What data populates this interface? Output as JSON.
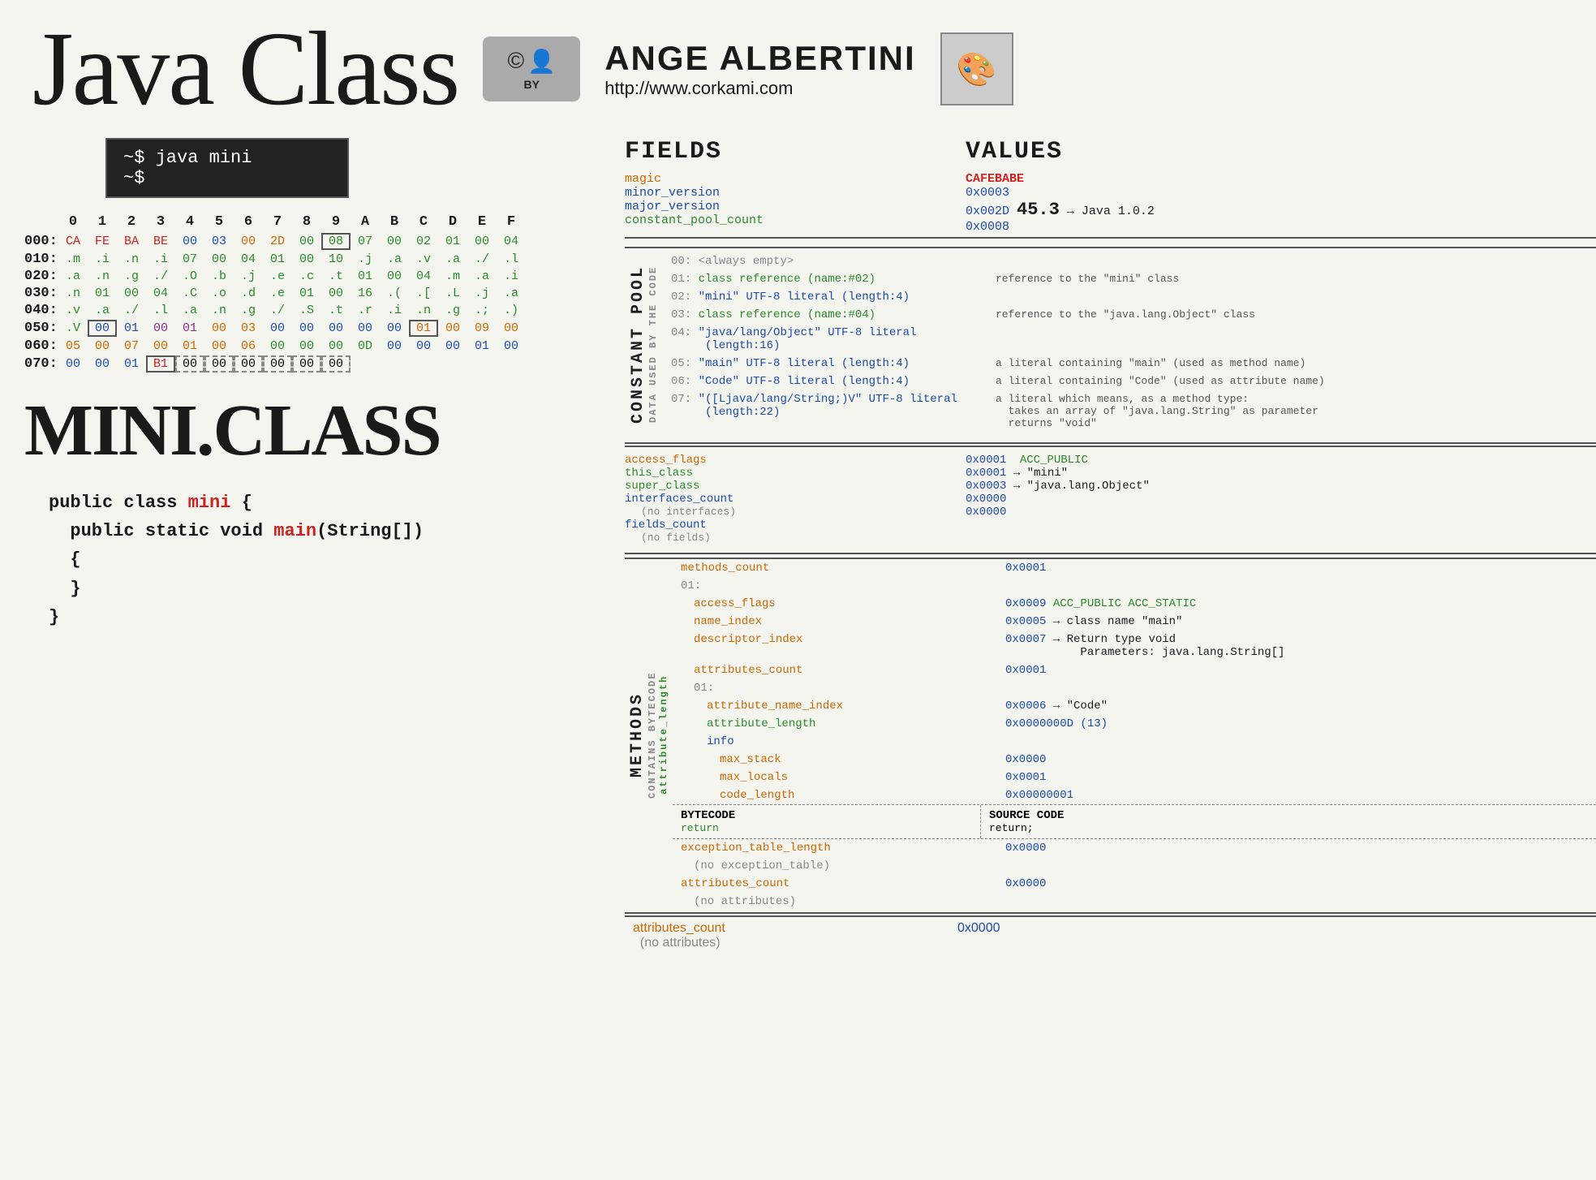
{
  "header": {
    "title": "Java Class",
    "cc_label": "BY",
    "author_name": "ANGE ALBERTINI",
    "author_url": "http://www.corkami.com"
  },
  "terminal": {
    "line1": "~$ java mini",
    "line2": "~$"
  },
  "hex_header": [
    "0",
    "1",
    "2",
    "3",
    "4",
    "5",
    "6",
    "7",
    "8",
    "9",
    "A",
    "B",
    "C",
    "D",
    "E",
    "F"
  ],
  "hex_rows": [
    {
      "addr": "000:",
      "cells": "CA FE BA BE 00 03 00 2D 00 08 07 00 02 01 00 04"
    },
    {
      "addr": "010:",
      "cells": ".m .i .n .i 07 00 04 01 00 10 .j .a .v .a ./ .l"
    },
    {
      "addr": "020:",
      "cells": ".a .n .g ./ .O .b .j .e .c .t 01 00 04 .m .a .i"
    },
    {
      "addr": "030:",
      "cells": ".n 01 00 04 .C .o .d .e 01 00 16 .( .[ .L .j .a"
    },
    {
      "addr": "040:",
      "cells": ".v .a ./ .l .a .n .g ./ .S .t .r .i .n .g .; .)"
    },
    {
      "addr": "050:",
      "cells": ".V 00 01 00 01 00 03 00 00 00 00 00 01 00 09 00"
    },
    {
      "addr": "060:",
      "cells": "05 00 07 00 01 00 06 00 00 00 0D 00 00 00 01 00"
    },
    {
      "addr": "070:",
      "cells": "00 00 01 B1 00 00 00 00 00 00"
    }
  ],
  "mini_class_title": "MINI.CLASS",
  "code": {
    "line1": "public class mini {",
    "line2": "  public static void main(String[])",
    "line3": "  {",
    "line4": "  }",
    "line5": "}"
  },
  "fields_section": {
    "title": "FIELDS",
    "items": [
      {
        "name": "magic",
        "color": "orange"
      },
      {
        "name": "minor_version",
        "color": "blue"
      },
      {
        "name": "major_version",
        "color": "blue"
      },
      {
        "name": "constant_pool_count",
        "color": "green"
      }
    ]
  },
  "values_section": {
    "title": "VALUES",
    "items": [
      {
        "val": "CAFEBABE",
        "color": "red"
      },
      {
        "val": "0x0003",
        "color": "blue"
      },
      {
        "val": "0x002D  45.3 → Java 1.0.2",
        "color": "blue"
      },
      {
        "val": "0x0008",
        "color": "blue"
      }
    ]
  },
  "constant_pool": {
    "label": "CONSTANT POOL",
    "sublabel": "DATA USED BY THE CODE",
    "count_label": "constant_pool_count",
    "entries": [
      {
        "num": "00:",
        "desc": "<always empty>",
        "note": ""
      },
      {
        "num": "01:",
        "desc_class": "class reference (name:#02)",
        "note": "reference to the \"mini\" class"
      },
      {
        "num": "02:",
        "desc_literal": "\"mini\" UTF-8 literal (length:4)",
        "note": ""
      },
      {
        "num": "03:",
        "desc_class": "class reference (name:#04)",
        "note": "reference to the \"java.lang.Object\" class"
      },
      {
        "num": "04:",
        "desc_literal": "\"java/lang/Object\" UTF-8 literal (length:16)",
        "note": ""
      },
      {
        "num": "05:",
        "desc_literal": "\"main\" UTF-8 literal (length:4)",
        "note": "a literal containing \"main\" (used as method name)"
      },
      {
        "num": "06:",
        "desc_literal": "\"Code\" UTF-8 literal (length:4)",
        "note": "a literal containing \"Code\" (used as attribute name)"
      },
      {
        "num": "07:",
        "desc_literal": "\"([Ljava/lang/String;)V\" UTF-8 literal (length:22)",
        "note": "a literal which means, as a method type:\n  takes an array of \"java.lang.String\" as parameter\n  returns \"void\""
      }
    ]
  },
  "access_flags_section": {
    "fields": [
      {
        "name": "access_flags",
        "color": "orange"
      },
      {
        "name": "this_class",
        "color": "blue"
      },
      {
        "name": "super_class",
        "color": "blue"
      },
      {
        "name": "interfaces_count",
        "color": "blue"
      },
      {
        "sub": "(no interfaces)"
      },
      {
        "name": "fields_count",
        "color": "blue"
      },
      {
        "sub": "(no fields)"
      }
    ],
    "values": [
      {
        "val": "0x0001",
        "extra": "ACC_PUBLIC",
        "extra_color": "green"
      },
      {
        "val": "0x0001 → \"mini\"",
        "color": "blue"
      },
      {
        "val": "0x0003 → \"java.lang.Object\"",
        "color": "blue"
      },
      {
        "val": "0x0000",
        "color": "blue"
      },
      {
        "val": ""
      },
      {
        "val": "0x0000",
        "color": "blue"
      },
      {
        "val": ""
      }
    ]
  },
  "methods_section": {
    "label": "METHODS",
    "sublabel": "CONTAINS BYTECODE",
    "attr_label": "attribute_length",
    "count_field": "methods_count",
    "count_val": "0x0001",
    "method_01_label": "01:",
    "method_fields": [
      {
        "name": "access_flags",
        "color": "orange",
        "indent": 1
      },
      {
        "name": "name_index",
        "color": "orange",
        "indent": 1
      },
      {
        "name": "descriptor_index",
        "color": "orange",
        "indent": 1
      },
      {
        "name": "attributes_count",
        "color": "orange",
        "indent": 1
      },
      {
        "sub": "01:",
        "indent": 1
      },
      {
        "name": "attribute_name_index",
        "color": "orange",
        "indent": 2
      },
      {
        "name": "attribute_length",
        "color": "green",
        "indent": 2
      },
      {
        "name": "info",
        "color": "blue",
        "indent": 2
      },
      {
        "name": "max_stack",
        "color": "orange",
        "indent": 3
      },
      {
        "name": "max_locals",
        "color": "orange",
        "indent": 3
      },
      {
        "name": "code_length",
        "color": "orange",
        "indent": 3
      }
    ],
    "method_values": [
      {
        "val": "0x0009",
        "extra": "ACC_PUBLIC ACC_STATIC",
        "extra_color": "green"
      },
      {
        "val": "0x0005 → class name \"main\"",
        "color": "blue"
      },
      {
        "val": "0x0007 → Return type void",
        "color": "blue"
      },
      {
        "val": "",
        "extra": "Parameters: java.lang.String[]"
      },
      {
        "val": "0x0001"
      },
      {
        "val": ""
      },
      {
        "val": "0x0006 → \"Code\"",
        "color": "blue"
      },
      {
        "val": "0x0000000D (13)",
        "color": "blue"
      },
      {
        "val": ""
      },
      {
        "val": "0x0000"
      },
      {
        "val": "0x0001"
      },
      {
        "val": "0x00000001"
      }
    ]
  },
  "bytecode": {
    "title": "BYTECODE",
    "entries": [
      "return"
    ],
    "source_title": "SOURCE CODE",
    "source_entries": [
      "return;"
    ]
  },
  "after_bytecode": {
    "fields": [
      {
        "name": "exception_table_length",
        "color": "orange"
      },
      {
        "sub": "(no exception_table)"
      },
      {
        "name": "attributes_count",
        "color": "orange"
      },
      {
        "sub": "(no attributes)"
      }
    ],
    "values": [
      {
        "val": "0x0000"
      },
      {
        "val": ""
      },
      {
        "val": "0x0000"
      },
      {
        "val": ""
      }
    ]
  },
  "bottom": {
    "field": "attributes_count",
    "field_color": "orange",
    "sub": "(no attributes)",
    "val": "0x0000"
  }
}
